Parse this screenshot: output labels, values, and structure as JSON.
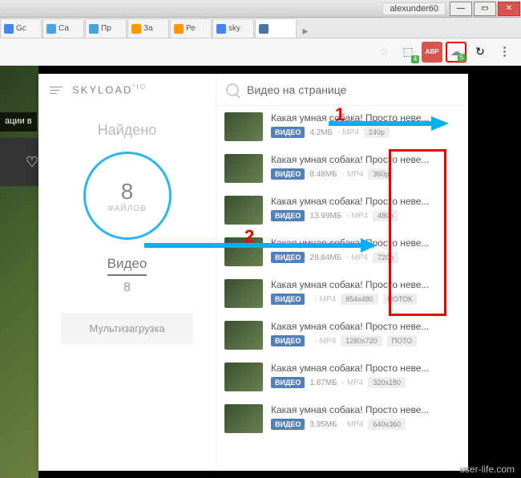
{
  "window": {
    "user": "alexunder60"
  },
  "tabs": [
    {
      "label": "Gc",
      "fav": "#4285f4"
    },
    {
      "label": "Са",
      "fav": "#4aa3df"
    },
    {
      "label": "Пр",
      "fav": "#4aa3df"
    },
    {
      "label": "За",
      "fav": "#ff9800"
    },
    {
      "label": "Ре",
      "fav": "#ff9800"
    },
    {
      "label": "sky",
      "fav": "#4285f4"
    },
    {
      "label": "",
      "fav": "#4c75a3",
      "active": true
    }
  ],
  "toolbar": {
    "badge1": "4",
    "badge2": "5",
    "abp": "ABP"
  },
  "bg": {
    "trunc": "ации в"
  },
  "popup": {
    "brand": "SKYLOAD",
    "brand_sup": "*IO",
    "found": "Найдено",
    "count": "8",
    "count_label": "ФАЙЛОВ",
    "video_label": "Видео",
    "video_count": "8",
    "multiload": "Мультизагрузка",
    "search_title": "Видео на странице",
    "items": [
      {
        "title": "Какая умная собака! Просто неве...",
        "badge": "ВИДЕО",
        "size": "4.2МБ",
        "fmt": "- MP4",
        "res": "240p"
      },
      {
        "title": "Какая умная собака! Просто неве...",
        "badge": "ВИДЕО",
        "size": "8.48МБ",
        "fmt": "- MP4",
        "res": "360p"
      },
      {
        "title": "Какая умная собака! Просто неве...",
        "badge": "ВИДЕО",
        "size": "13.99МБ",
        "fmt": "- MP4",
        "res": "480p"
      },
      {
        "title": "Какая умная собака! Просто неве...",
        "badge": "ВИДЕО",
        "size": "28.84МБ",
        "fmt": "- MP4",
        "res": "720p"
      },
      {
        "title": "Какая умная собака! Просто неве...",
        "badge": "ВИДЕО",
        "size": "",
        "fmt": "- MP4",
        "res": "854x480",
        "res2": "ПОТОК"
      },
      {
        "title": "Какая умная собака! Просто неве...",
        "badge": "ВИДЕО",
        "size": "",
        "fmt": "- MP4",
        "res": "1280x720",
        "res2": "ПОТО"
      },
      {
        "title": "Какая умная собака! Просто неве...",
        "badge": "ВИДЕО",
        "size": "1.87МБ",
        "fmt": "- MP4",
        "res": "320x180"
      },
      {
        "title": "Какая умная собака! Просто неве...",
        "badge": "ВИДЕО",
        "size": "3.95МБ",
        "fmt": "- MP4",
        "res": "640x360"
      }
    ]
  },
  "annotations": {
    "n1": "1",
    "n2": "2"
  },
  "watermark": "user-life.com"
}
